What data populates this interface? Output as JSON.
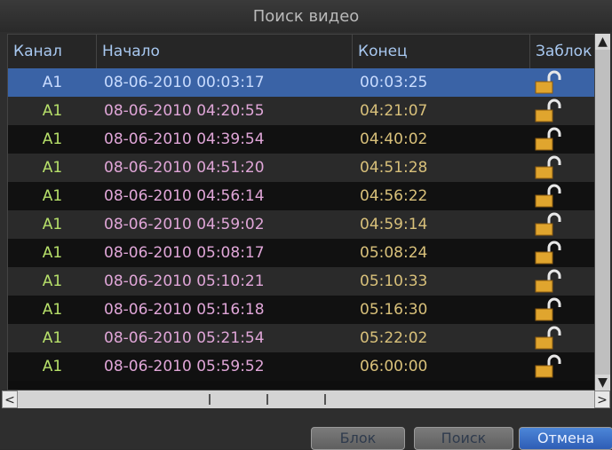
{
  "window": {
    "title": "Поиск видео"
  },
  "table": {
    "columns": [
      "Канал",
      "Начало",
      "Конец",
      "Заблок"
    ],
    "rows": [
      {
        "channel": "A1",
        "start": "08-06-2010 00:03:17",
        "end": "00:03:25"
      },
      {
        "channel": "A1",
        "start": "08-06-2010 04:20:55",
        "end": "04:21:07"
      },
      {
        "channel": "A1",
        "start": "08-06-2010 04:39:54",
        "end": "04:40:02"
      },
      {
        "channel": "A1",
        "start": "08-06-2010 04:51:20",
        "end": "04:51:28"
      },
      {
        "channel": "A1",
        "start": "08-06-2010 04:56:14",
        "end": "04:56:22"
      },
      {
        "channel": "A1",
        "start": "08-06-2010 04:59:02",
        "end": "04:59:14"
      },
      {
        "channel": "A1",
        "start": "08-06-2010 05:08:17",
        "end": "05:08:24"
      },
      {
        "channel": "A1",
        "start": "08-06-2010 05:10:21",
        "end": "05:10:33"
      },
      {
        "channel": "A1",
        "start": "08-06-2010 05:16:18",
        "end": "05:16:30"
      },
      {
        "channel": "A1",
        "start": "08-06-2010 05:21:54",
        "end": "05:22:02"
      },
      {
        "channel": "A1",
        "start": "08-06-2010 05:59:52",
        "end": "06:00:00"
      }
    ],
    "selected_row": 0
  },
  "buttons": {
    "lock": "Блок",
    "search": "Поиск",
    "cancel": "Отмена"
  },
  "icons": {
    "lock": "open-padlock-icon",
    "scroll_up": "▲",
    "scroll_down": "▼",
    "scroll_left": "<",
    "scroll_right": ">"
  },
  "colors": {
    "selected_row": "#3a63a6",
    "channel_text": "#b7e06a",
    "time_text": "#e0a6d8"
  }
}
